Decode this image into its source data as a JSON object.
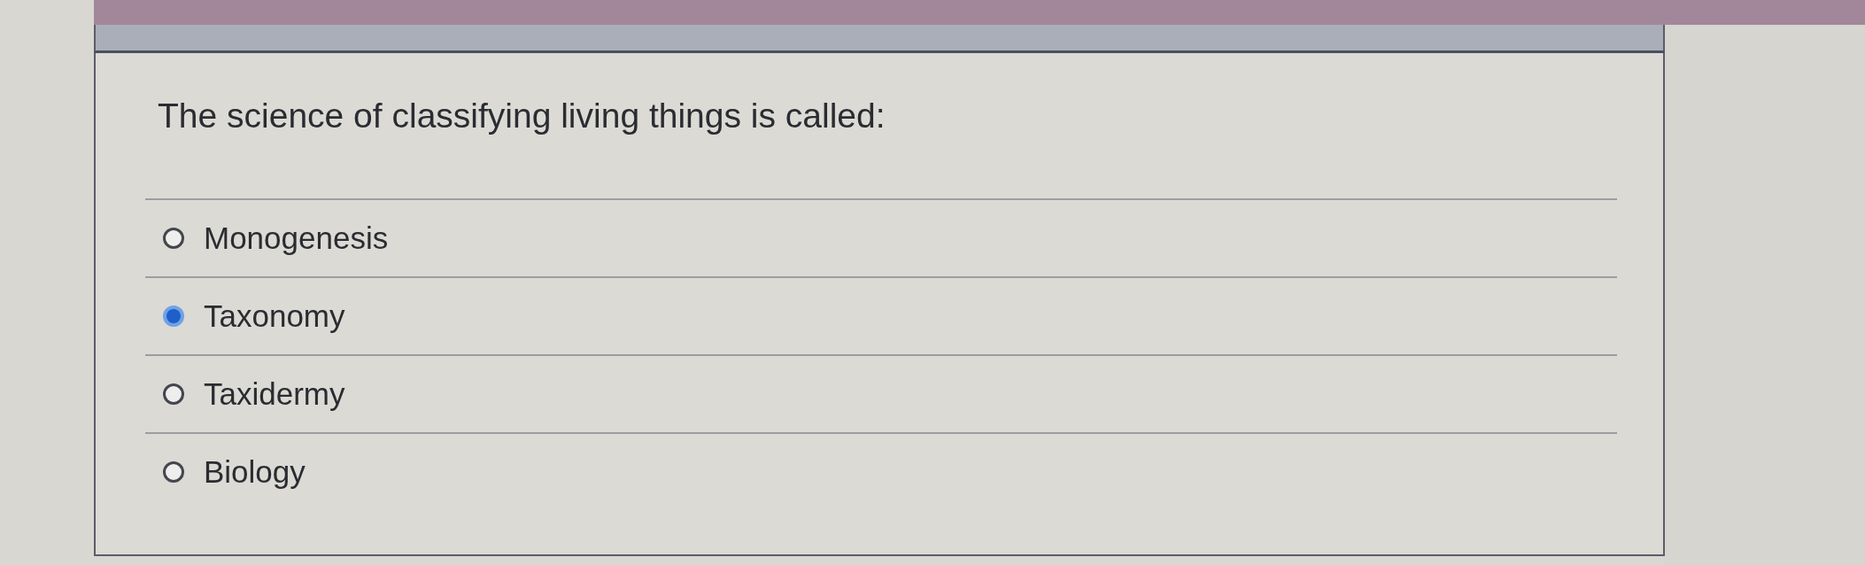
{
  "question": {
    "text": "The science of classifying living things is called:"
  },
  "options": [
    {
      "label": "Monogenesis",
      "selected": false
    },
    {
      "label": "Taxonomy",
      "selected": true
    },
    {
      "label": "Taxidermy",
      "selected": false
    },
    {
      "label": "Biology",
      "selected": false
    }
  ]
}
